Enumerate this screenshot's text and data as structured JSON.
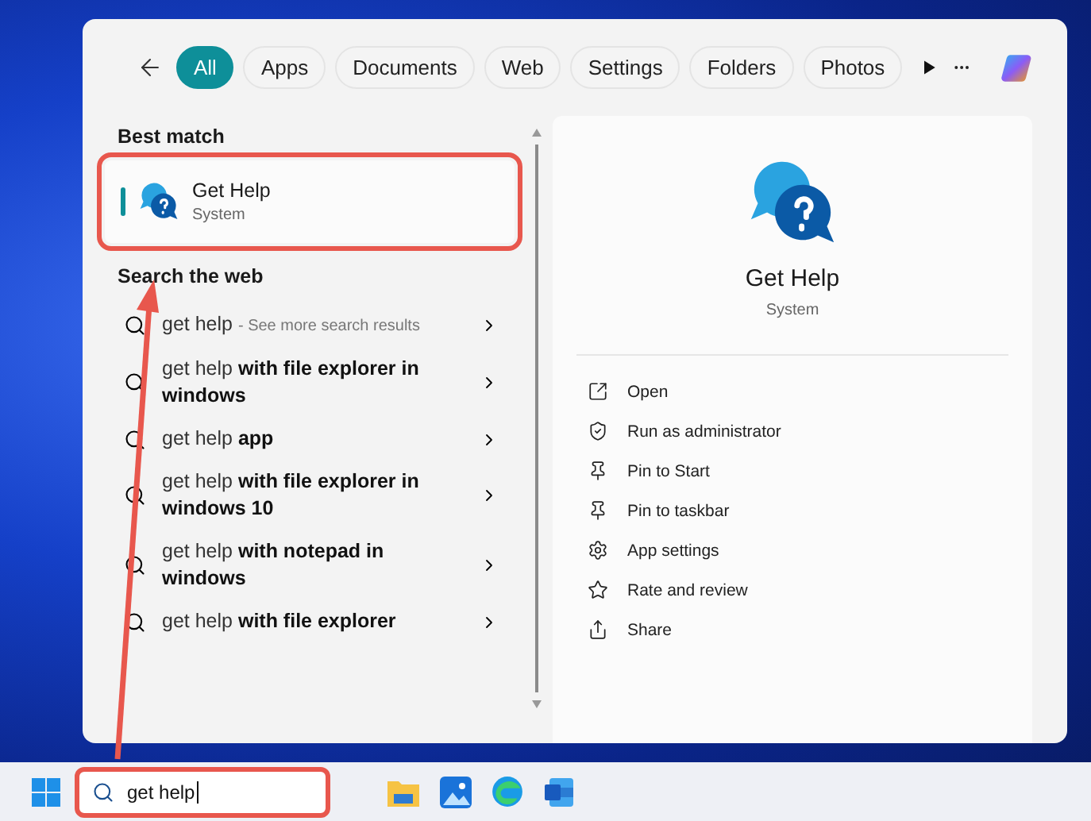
{
  "filters": [
    {
      "label": "All",
      "selected": true
    },
    {
      "label": "Apps",
      "selected": false
    },
    {
      "label": "Documents",
      "selected": false
    },
    {
      "label": "Web",
      "selected": false
    },
    {
      "label": "Settings",
      "selected": false
    },
    {
      "label": "Folders",
      "selected": false
    },
    {
      "label": "Photos",
      "selected": false
    }
  ],
  "best_match": {
    "heading": "Best match",
    "title": "Get Help",
    "subtitle": "System",
    "selected": true,
    "highlighted": true
  },
  "web": {
    "heading": "Search the web",
    "results": [
      {
        "text": "get help",
        "note": "- See more search results"
      },
      {
        "text": "get help **with file explorer in windows**"
      },
      {
        "text": "get help **app**"
      },
      {
        "text": "get help **with file explorer in windows 10**"
      },
      {
        "text": "get help **with notepad in windows**"
      },
      {
        "text": "get help **with file explorer**"
      }
    ]
  },
  "detail": {
    "title": "Get Help",
    "subtitle": "System",
    "actions": [
      {
        "kind": "open",
        "label": "Open"
      },
      {
        "kind": "admin",
        "label": "Run as administrator"
      },
      {
        "kind": "pin",
        "label": "Pin to Start"
      },
      {
        "kind": "pin",
        "label": "Pin to taskbar"
      },
      {
        "kind": "settings",
        "label": "App settings"
      },
      {
        "kind": "rate",
        "label": "Rate and review"
      },
      {
        "kind": "share",
        "label": "Share"
      }
    ]
  },
  "taskbar": {
    "search": {
      "value": "get help",
      "highlighted": true
    },
    "apps": [
      {
        "kind": "files"
      },
      {
        "kind": "photos"
      },
      {
        "kind": "edge"
      },
      {
        "kind": "word"
      }
    ]
  }
}
